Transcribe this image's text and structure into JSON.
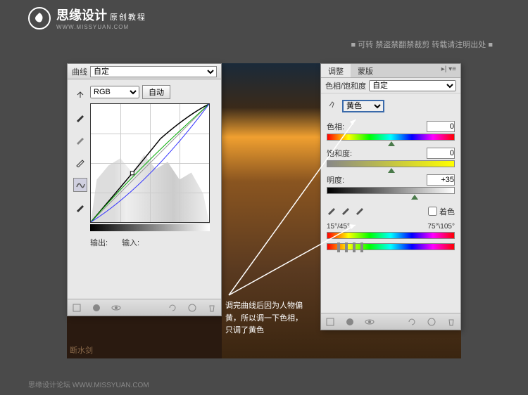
{
  "logo": {
    "main": "思缘设计",
    "sub": "原创教程",
    "url": "WWW.MISSYUAN.COM"
  },
  "header": {
    "text": "■ 可转  禁盗禁翻禁裁剪  转载请注明出处 ■"
  },
  "curves": {
    "title": "曲线",
    "preset": "自定",
    "channel": "RGB",
    "auto": "自动",
    "output_label": "输出:",
    "input_label": "输入:"
  },
  "hsl": {
    "tabs": {
      "adjust": "调整",
      "mask": "蒙版"
    },
    "title": "色相/饱和度",
    "preset": "自定",
    "color": "黄色",
    "hue_label": "色相:",
    "hue_value": "0",
    "sat_label": "饱和度:",
    "sat_value": "0",
    "light_label": "明度:",
    "light_value": "+35",
    "colorize": "着色",
    "range_left": "15°/45°",
    "range_right": "75°\\105°"
  },
  "annotation": "调完曲线后因为人物偏黄，所以调一下色相，只调了黄色",
  "watermark": "断水剑",
  "bottom": "思缘设计论坛  WWW.MISSYUAN.COM"
}
